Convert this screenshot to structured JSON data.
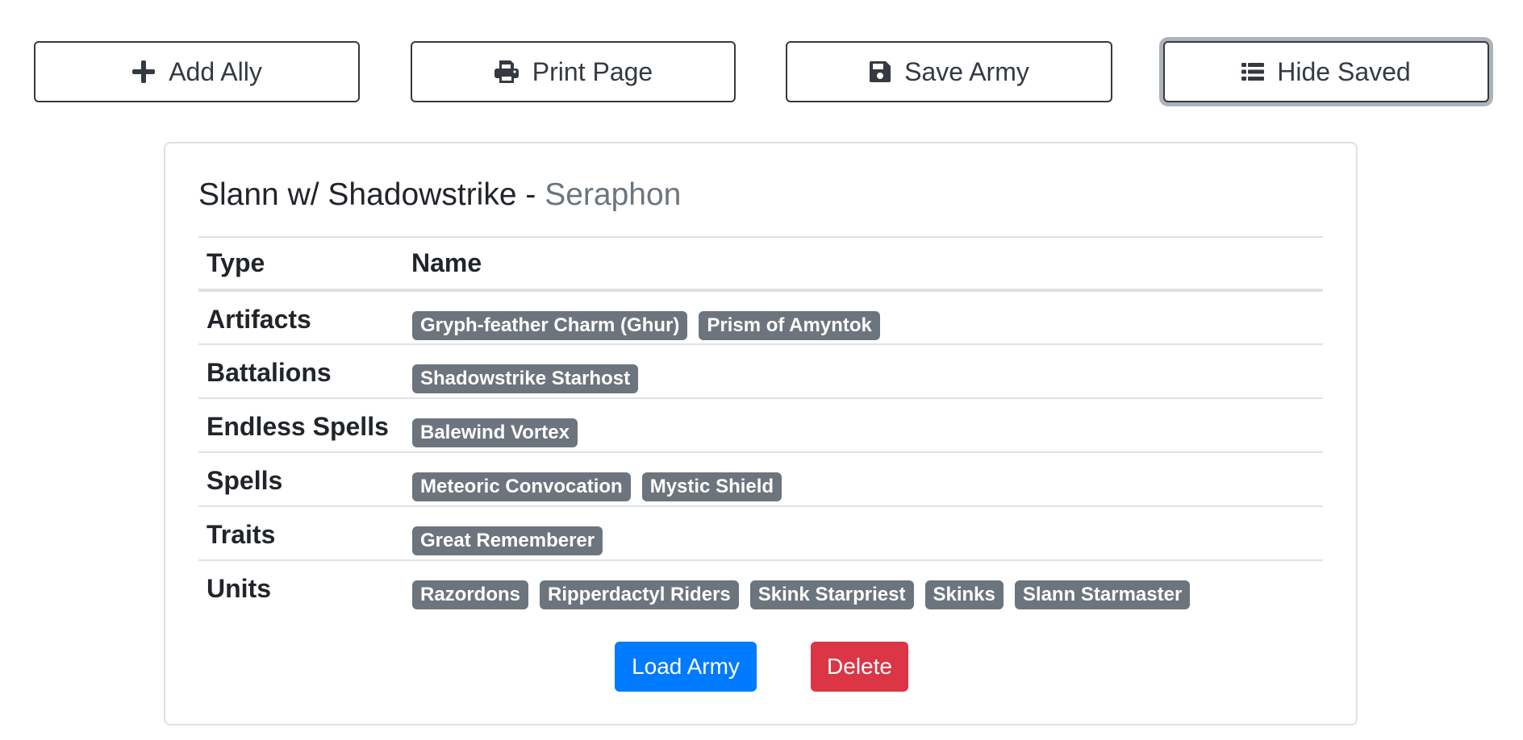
{
  "toolbar": {
    "add_ally_label": "Add Ally",
    "print_label": "Print Page",
    "save_label": "Save Army",
    "hide_saved_label": "Hide Saved"
  },
  "army": {
    "name": "Slann w/ Shadowstrike",
    "separator": "-",
    "faction": "Seraphon",
    "columns": {
      "type": "Type",
      "name": "Name"
    },
    "rows": [
      {
        "type": "Artifacts",
        "items": [
          "Gryph-feather Charm (Ghur)",
          "Prism of Amyntok"
        ]
      },
      {
        "type": "Battalions",
        "items": [
          "Shadowstrike Starhost"
        ]
      },
      {
        "type": "Endless Spells",
        "items": [
          "Balewind Vortex"
        ]
      },
      {
        "type": "Spells",
        "items": [
          "Meteoric Convocation",
          "Mystic Shield"
        ]
      },
      {
        "type": "Traits",
        "items": [
          "Great Rememberer"
        ]
      },
      {
        "type": "Units",
        "items": [
          "Razordons",
          "Ripperdactyl Riders",
          "Skink Starpriest",
          "Skinks",
          "Slann Starmaster"
        ]
      }
    ],
    "load_label": "Load Army",
    "delete_label": "Delete"
  },
  "colors": {
    "primary": "#007bff",
    "danger": "#dc3545",
    "badge": "#6c757d",
    "faction_text": "#6c757d",
    "outline": "#343a40"
  },
  "icons": {
    "add_ally": "plus-icon",
    "print": "printer-icon",
    "save": "floppy-disk-icon",
    "hide_saved": "list-icon"
  }
}
